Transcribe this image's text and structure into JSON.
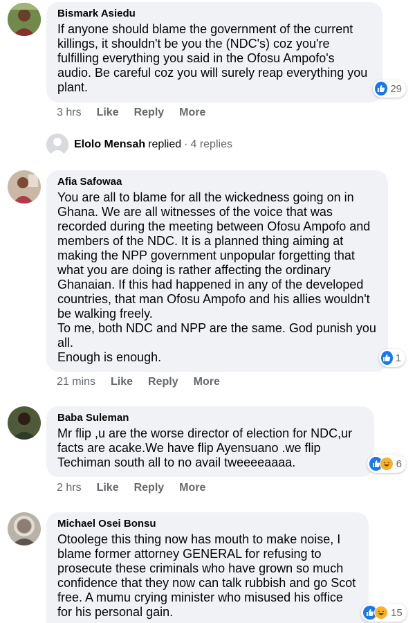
{
  "comments": [
    {
      "author": "Bismark Asiedu",
      "text": "If anyone should blame the government of the current killings, it shouldn't be you the (NDC's) coz you're fulfilling everything you said in the Ofosu Ampofo's audio. Be careful coz you will surely reap everything you plant.",
      "reaction_count": "29",
      "time": "3 hrs",
      "like": "Like",
      "reply": "Reply",
      "more": "More"
    },
    {
      "author": "Afia Safowaa",
      "text": "You are all to blame for all the wickedness going on in Ghana. We are all witnesses of the voice that was recorded during the meeting between Ofosu Ampofo and members of the NDC. It is a planned thing aiming at making the NPP government unpopular forgetting that what you are doing is rather affecting the ordinary Ghanaian. If this had happened in any of the developed countries, that man Ofosu Ampofo and his allies wouldn't be walking freely.\nTo me, both NDC and NPP are the same. God punish you all.\nEnough is enough.",
      "reaction_count": "1",
      "time": "21 mins",
      "like": "Like",
      "reply": "Reply",
      "more": "More"
    },
    {
      "author": "Baba Suleman",
      "text": "Mr flip ,u are the worse director of election for NDC,ur facts are acake.We have flip Ayensuano .we flip Techiman south all to no avail tweeeeaaaa.",
      "reaction_count": "6",
      "time": "2 hrs",
      "like": "Like",
      "reply": "Reply",
      "more": "More"
    },
    {
      "author": "Michael Osei Bonsu",
      "text": "Otoolege this thing now has mouth to make noise, I blame former attorney GENERAL for refusing to prosecute these criminals who have grown so much confidence that they now can talk rubbish and go Scot free. A mumu crying minister who misused his office for his personal gain.",
      "reaction_count": "15"
    }
  ],
  "reply_summary": {
    "name": "Elolo Mensah",
    "verb": "replied",
    "separator": "·",
    "count": "4 replies"
  },
  "icons": {
    "like": "thumbs-up-icon",
    "haha": "laughing-face-icon",
    "avatar_placeholder": "person-silhouette-icon"
  },
  "colors": {
    "bubble": "#f0f2f5",
    "like_blue": "#1877f2",
    "haha_yellow": "#f7b125",
    "secondary_text": "#65676b"
  }
}
